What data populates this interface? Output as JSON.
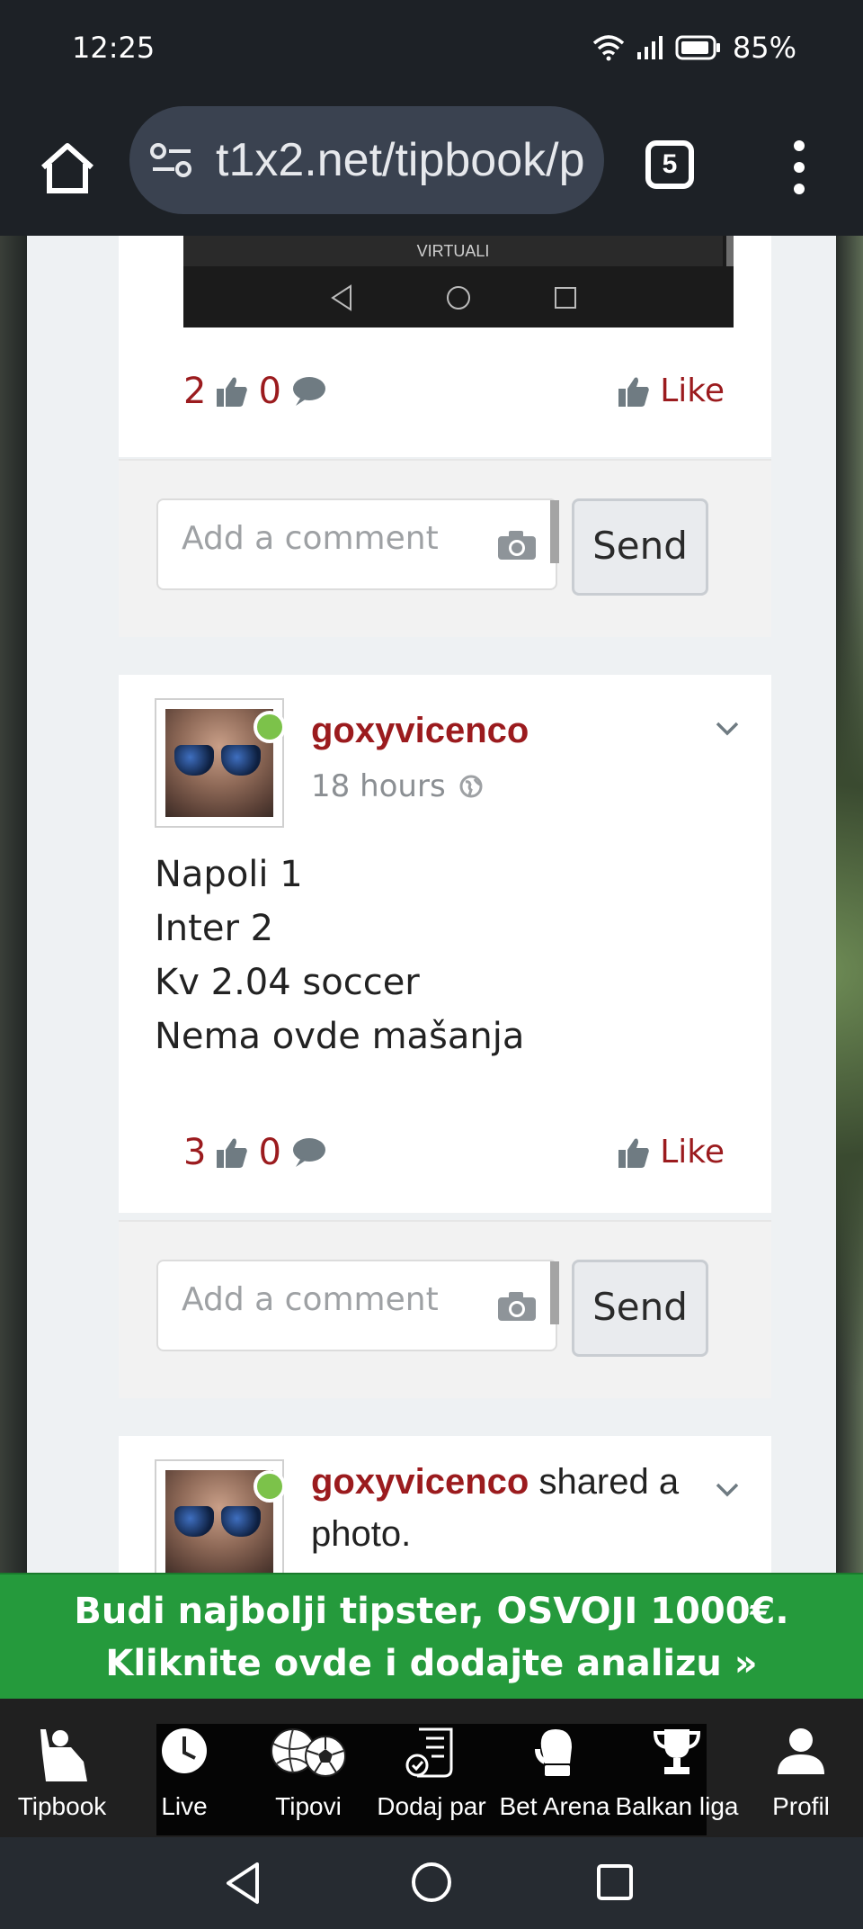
{
  "status_bar": {
    "time": "12:25",
    "battery": "85%"
  },
  "browser": {
    "url": "t1x2.net/tipbook/p",
    "tab_count": "5"
  },
  "top_post": {
    "screenshot_label": "VIRTUALI",
    "likes": "2",
    "comments": "0",
    "like_label": "Like"
  },
  "comment_form_1": {
    "placeholder": "Add a comment",
    "send_label": "Send"
  },
  "post2": {
    "username": "goxyvicenco",
    "time": "18 hours",
    "lines": [
      "Napoli 1",
      "Inter 2",
      "Kv 2.04 soccer",
      "Nema ovde mašanja"
    ],
    "likes": "3",
    "comments": "0",
    "like_label": "Like"
  },
  "comment_form_2": {
    "placeholder": "Add a comment",
    "send_label": "Send"
  },
  "post3": {
    "username": "goxyvicenco",
    "action_text": " shared a photo."
  },
  "banner": {
    "line1": "Budi najbolji tipster, OSVOJI 1000€.",
    "line2": "Kliknite ovde i dodajte analizu »"
  },
  "bottom_nav": [
    {
      "label": "Tipbook",
      "icon": "tipster-icon"
    },
    {
      "label": "Live",
      "icon": "clock-icon"
    },
    {
      "label": "Tipovi",
      "icon": "balls-icon"
    },
    {
      "label": "Dodaj par",
      "icon": "ticket-icon"
    },
    {
      "label": "Bet Arena",
      "icon": "boxing-glove-icon"
    },
    {
      "label": "Balkan liga",
      "icon": "trophy-icon"
    },
    {
      "label": "Profil",
      "icon": "user-icon"
    }
  ],
  "colors": {
    "accent": "#9b1b1e",
    "banner": "#259a3c",
    "online": "#7cc24a"
  }
}
